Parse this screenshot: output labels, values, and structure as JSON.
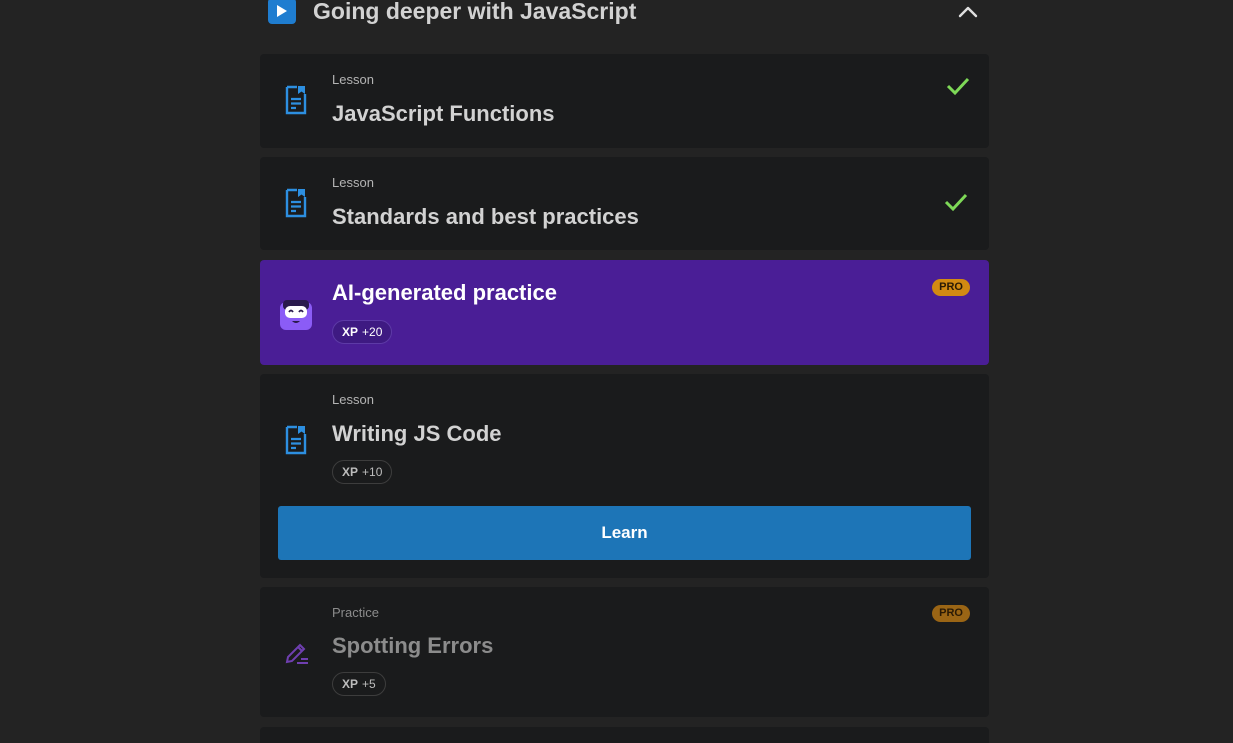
{
  "module": {
    "title": "Going deeper with JavaScript",
    "icon": "play-icon",
    "collapse_icon": "chevron-up-icon"
  },
  "items": [
    {
      "type_label": "Lesson",
      "title": "JavaScript Functions",
      "icon": "lesson-document-icon",
      "status": "completed"
    },
    {
      "type_label": "Lesson",
      "title": "Standards and best practices",
      "icon": "lesson-document-icon",
      "status": "completed"
    },
    {
      "title": "AI-generated practice",
      "icon": "ai-robot-icon",
      "badge": "PRO",
      "xp_label": "XP",
      "xp_value": "+20"
    },
    {
      "type_label": "Lesson",
      "title": "Writing JS Code",
      "icon": "lesson-document-icon",
      "xp_label": "XP",
      "xp_value": "+10",
      "button_label": "Learn"
    },
    {
      "type_label": "Practice",
      "title": "Spotting Errors",
      "icon": "pencil-icon",
      "badge": "PRO",
      "xp_label": "XP",
      "xp_value": "+5"
    }
  ],
  "colors": {
    "background": "#232323",
    "card": "#1a1b1c",
    "pro_card": "#4a1e96",
    "accent_blue": "#1d75b7",
    "check_green": "#7ed957",
    "pro_badge": "#d28a12"
  }
}
